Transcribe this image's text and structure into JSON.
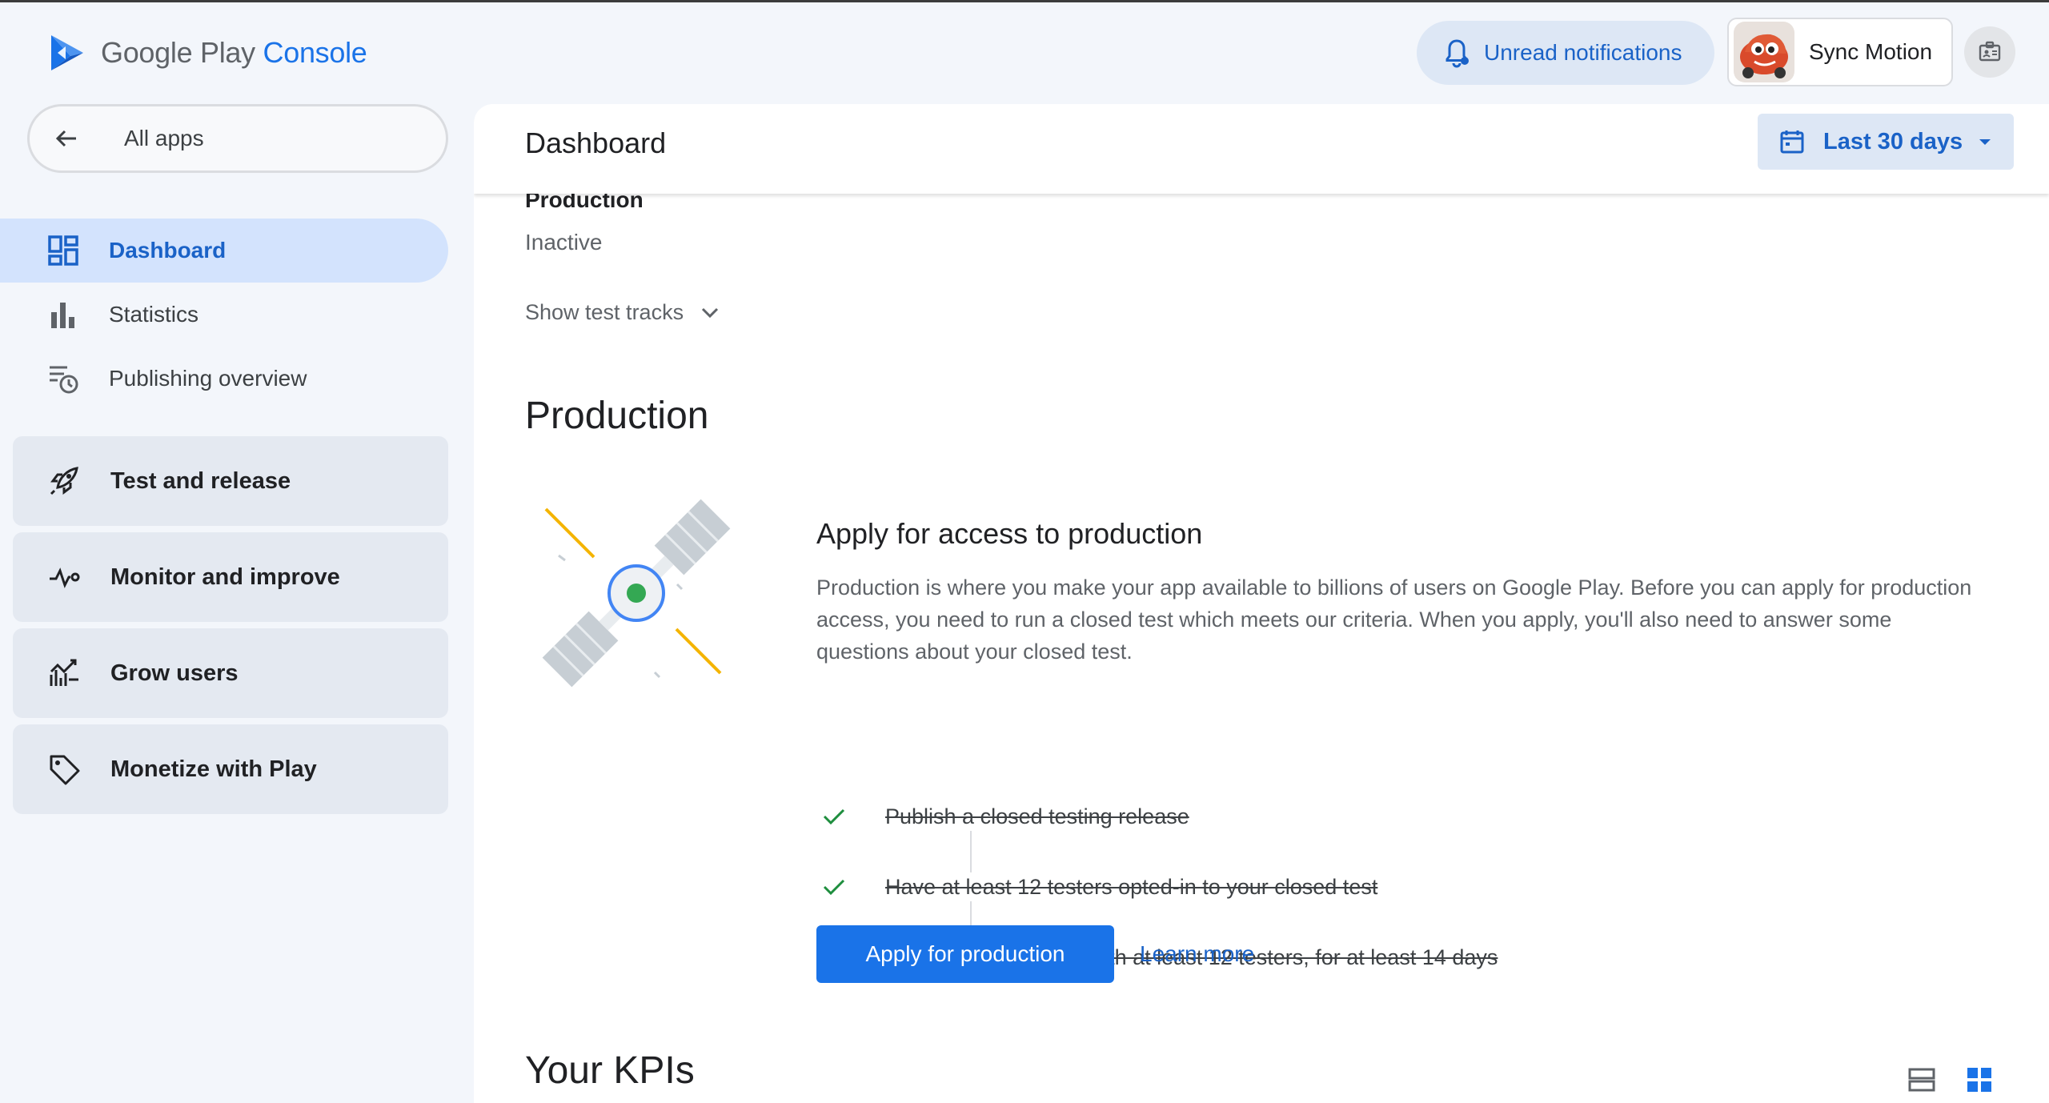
{
  "header": {
    "logo_word_main": "Google Play",
    "logo_word_accent": "Console",
    "notifications_label": "Unread notifications",
    "account_name": "Sync Motion"
  },
  "sidebar": {
    "all_apps_label": "All apps",
    "items": [
      {
        "label": "Dashboard",
        "icon": "dashboard-icon",
        "active": true
      },
      {
        "label": "Statistics",
        "icon": "bar-chart-icon"
      },
      {
        "label": "Publishing overview",
        "icon": "publishing-overview-icon"
      }
    ],
    "groups": [
      {
        "label": "Test and release",
        "icon": "rocket-icon"
      },
      {
        "label": "Monitor and improve",
        "icon": "vitals-icon"
      },
      {
        "label": "Grow users",
        "icon": "growth-icon"
      },
      {
        "label": "Monetize with Play",
        "icon": "tag-icon"
      }
    ]
  },
  "main": {
    "page_title": "Dashboard",
    "date_range": "Last 30 days",
    "track": {
      "label": "Production",
      "status": "Inactive"
    },
    "show_test_tracks": "Show test tracks",
    "section_title": "Production",
    "apply": {
      "title": "Apply for access to production",
      "description": "Production is where you make your app available to billions of users on Google Play. Before you can apply for production access, you need to run a closed test which meets our criteria. When you apply, you'll also need to answer some questions about your closed test.",
      "checklist": [
        "Publish a closed testing release",
        "Have at least 12 testers opted-in to your closed test",
        "Run your closed test with at least 12 testers, for at least 14 days"
      ],
      "button_label": "Apply for production",
      "learn_more": "Learn more"
    },
    "kpi_title": "Your KPIs"
  },
  "colors": {
    "accent": "#1a73e8",
    "accent_dark": "#1a62c7",
    "active_nav_bg": "#d3e3fd",
    "check_green": "#1e8e3e"
  }
}
